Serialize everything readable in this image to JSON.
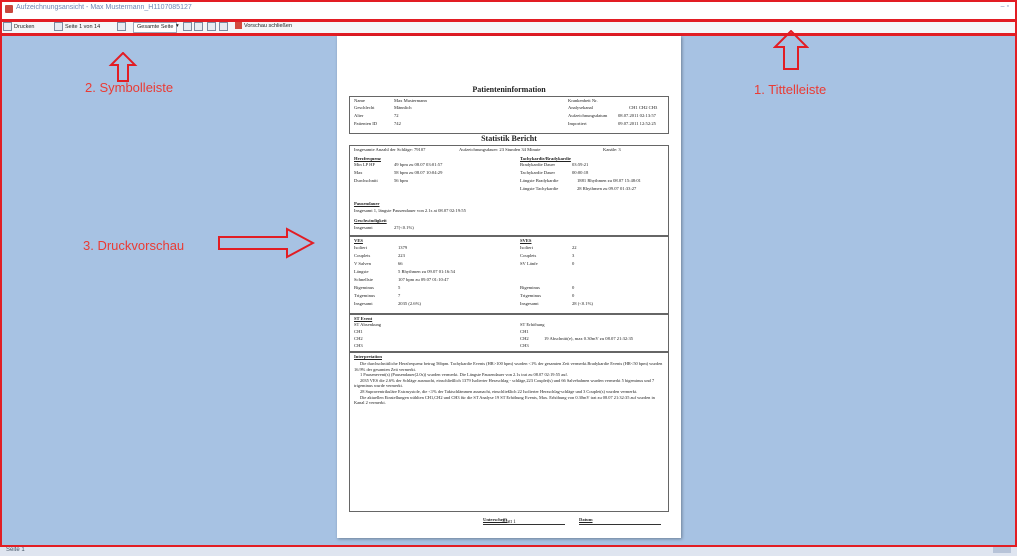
{
  "titlebar": {
    "title": "Aufzeichnungsansicht - Max Mustermann_H1107085127",
    "controls": "–  ▫"
  },
  "toolbar": {
    "print": "Drucken",
    "page": "Seite 1 von 14",
    "view": "Gesamte Seite",
    "close_preview": "Vorschau schließen",
    "icons": [
      "printer-icon",
      "page-icon",
      "zoom-in-icon",
      "zoom-out-icon",
      "single-page-icon",
      "multi-page-icon"
    ]
  },
  "annotations": {
    "titlebar": "1. Tittelleiste",
    "toolbar": "2. Symbolleiste",
    "preview": "3. Druckvorschau",
    "color": "#ea3b34"
  },
  "status": {
    "text": "Seite 1"
  },
  "doc": {
    "patient_title": "Patienteninformation",
    "patient": {
      "left": [
        [
          "Name",
          "Max Mustermann"
        ],
        [
          "Geschlecht",
          "Männlich"
        ],
        [
          "Alter",
          "72"
        ],
        [
          "Patienten ID",
          "742"
        ]
      ],
      "right": [
        [
          "Krankenbett Nr.",
          ""
        ],
        [
          "Analysekanal",
          "CH1  CH2  CH3"
        ],
        [
          "Aufzeichnungsdatum",
          "08.07.2011 02:13:57"
        ],
        [
          "Importiert",
          "09.07.2011 12:52:25"
        ]
      ]
    },
    "stat_title": "Statistik Bericht",
    "summary": {
      "beats": "Insgesamte Anzahl der Schläge: 79107",
      "duration": "Aufzeichnungsdauer: 23 Stunden 34 Minute",
      "channels": "Kanäle: 3"
    },
    "hr": {
      "title": "Herzfrequenz",
      "rows": [
        [
          "Min LP HF",
          "49 bpm   zu 08.07 03:01:57"
        ],
        [
          "Max",
          "58 bpm   zu 08.07 10:04:29"
        ],
        [
          "Durchschnitt",
          "56 bpm"
        ]
      ]
    },
    "tachy": {
      "title": "Tachykardie/Bradykardie",
      "rows": [
        [
          "Bradykardie Dauer",
          "03:59:21"
        ],
        [
          "Tachykardie Dauer",
          "00:00:18"
        ],
        [
          "Längste Bradykardie",
          "1881 Rhythmen  zu 08.07 15:48:01"
        ],
        [
          "Längste Tachykardie",
          "28 Rhythmen  zu 09.07 01:33:27"
        ]
      ]
    },
    "pause": {
      "title": "Pausendauer",
      "text": "Insgesamt   1, längste Pausendauer von 2.1s at 08.07 02:19:55"
    },
    "speed": {
      "title": "Geschwindigkeit",
      "label": "Insgesamt",
      "value": "27(<0.1%)"
    },
    "ves": {
      "title": "VES",
      "rows": [
        [
          "Isoliert",
          "1379"
        ],
        [
          "Couplets",
          "223"
        ],
        [
          "V Salven",
          "66"
        ],
        [
          "Längste",
          "5  Rhythmen zu 09.07 01:16:54"
        ],
        [
          "Schnellste",
          "107  bpm zu 09.07 01:10:47"
        ],
        [
          "Bigeminus",
          "5"
        ],
        [
          "Trigeminus",
          "7"
        ],
        [
          "Insgesamt",
          "2035 (2.6%)"
        ]
      ]
    },
    "sves": {
      "title": "SVES",
      "rows": [
        [
          "Isoliert",
          "22"
        ],
        [
          "Couplets",
          "3"
        ],
        [
          "SV Länfe",
          "0"
        ],
        [
          "",
          ""
        ],
        [
          "",
          ""
        ],
        [
          "Bigeminus",
          "0"
        ],
        [
          "Trigeminus",
          "0"
        ],
        [
          "Insgesamt",
          "28 (<0.1%)"
        ]
      ]
    },
    "st": {
      "title": "ST Event",
      "left": [
        "ST Absenkung",
        "CH1",
        "CH2",
        "CH3"
      ],
      "right": [
        "ST Erhöhung",
        "CH1",
        "CH2",
        "CH3"
      ],
      "right_value": "19  Abschnitt(e), max 0.30mV zu 08.07 21:32:35"
    },
    "interp": {
      "title": "Interpretation",
      "paras": [
        "Die durchschnittliche Herzfrequenz betrug 56bpm. Tachykardie Events (HR>100 bpm) wurden <1% der gesamten Zeit vermerkt.Bradykardie Events (HR<50 bpm) wurden 16.9% der gesamten Zeit vermerkt.",
        "1 Pausenevent(s) (Pausendauer(2.0s)) wurden vermerkt. Die Längste Pausendauer von 2.1s trat zu 08.07 02:19:55 auf.",
        "2035 VES die 2.6% der Schläge ausmacht, einschließlich 1379 Isolierter Herzschlag - schläge,223 Couplet(s) und 66 Salvebahnen wurden vermerkt 5 bigeminus und 7 trigeminus wurde vermerkt.",
        "28 Supraventrikuläre Extrasystole, die <1% der Taktschlämmen ausmacht, einschließlich 22 Isolierter Herzschlag-schläge und 3 Couplet(s) wurden vermerkt.",
        "Die aktuellen Einstellungen wählten CH1,CH2 und CH3 für die ST Analyse 19 ST Erhöhung Events, Max. Erhöhung von 0.30mV trat zu 08.07 21:32:35 auf wurden in Kanal 2 vermerkt."
      ]
    },
    "sign": {
      "signature": "Unterschrift",
      "date": "Datum"
    },
    "footer": "Blatt 1"
  }
}
